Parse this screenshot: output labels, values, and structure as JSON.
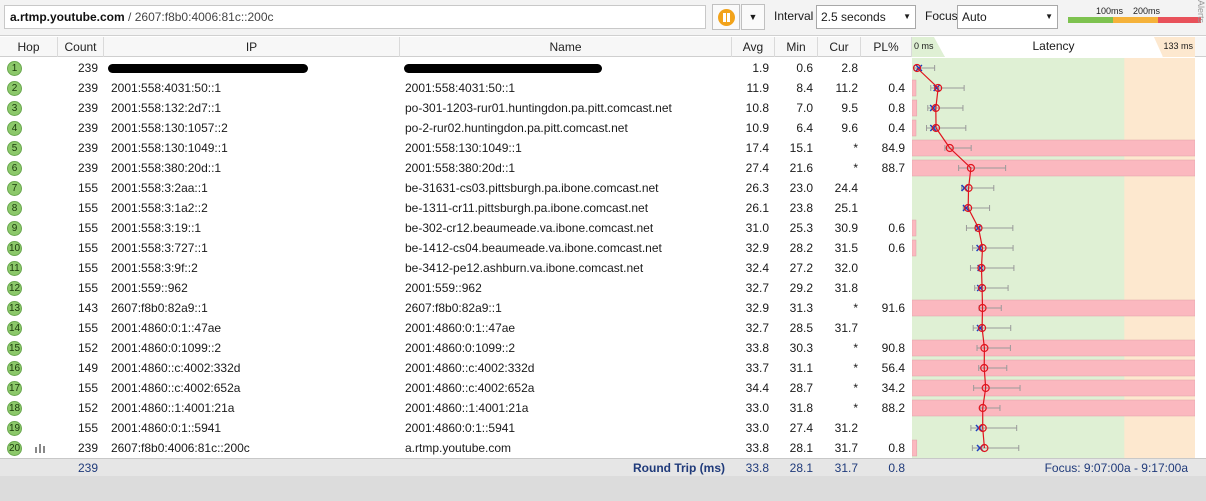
{
  "toolbar": {
    "host": "a.rtmp.youtube.com",
    "separator": "/",
    "ip": "2607:f8b0:4006:81c::200c",
    "interval_label": "Interval",
    "interval_value": "2.5 seconds",
    "focus_label": "Focus",
    "focus_value": "Auto",
    "legend_100": "100ms",
    "legend_200": "200ms",
    "alerts_label": "Alerts"
  },
  "columns": {
    "hop": "Hop",
    "count": "Count",
    "ip": "IP",
    "name": "Name",
    "avg": "Avg",
    "min": "Min",
    "cur": "Cur",
    "pl": "PL%",
    "latency": "Latency"
  },
  "latency_scale": {
    "min_label": "0 ms",
    "max_label": "133 ms"
  },
  "colors": {
    "good": "#dff0d4",
    "warn": "#fde8cf",
    "bad": "#fbb8bf",
    "line": "#e0141e",
    "hop_badge": "#8cc86a"
  },
  "hops": [
    {
      "hop": "1",
      "count": "239",
      "ip": "",
      "name": "",
      "avg": "1.9",
      "min": "0.6",
      "cur": "2.8",
      "pl": "",
      "redacted": true
    },
    {
      "hop": "2",
      "count": "239",
      "ip": "2001:558:4031:50::1",
      "name": "2001:558:4031:50::1",
      "avg": "11.9",
      "min": "8.4",
      "cur": "11.2",
      "pl": "0.4"
    },
    {
      "hop": "3",
      "count": "239",
      "ip": "2001:558:132:2d7::1",
      "name": "po-301-1203-rur01.huntingdon.pa.pitt.comcast.net",
      "avg": "10.8",
      "min": "7.0",
      "cur": "9.5",
      "pl": "0.8"
    },
    {
      "hop": "4",
      "count": "239",
      "ip": "2001:558:130:1057::2",
      "name": "po-2-rur02.huntingdon.pa.pitt.comcast.net",
      "avg": "10.9",
      "min": "6.4",
      "cur": "9.6",
      "pl": "0.4"
    },
    {
      "hop": "5",
      "count": "239",
      "ip": "2001:558:130:1049::1",
      "name": "2001:558:130:1049::1",
      "avg": "17.4",
      "min": "15.1",
      "cur": "*",
      "pl": "84.9"
    },
    {
      "hop": "6",
      "count": "239",
      "ip": "2001:558:380:20d::1",
      "name": "2001:558:380:20d::1",
      "avg": "27.4",
      "min": "21.6",
      "cur": "*",
      "pl": "88.7"
    },
    {
      "hop": "7",
      "count": "155",
      "ip": "2001:558:3:2aa::1",
      "name": "be-31631-cs03.pittsburgh.pa.ibone.comcast.net",
      "avg": "26.3",
      "min": "23.0",
      "cur": "24.4",
      "pl": ""
    },
    {
      "hop": "8",
      "count": "155",
      "ip": "2001:558:3:1a2::2",
      "name": "be-1311-cr11.pittsburgh.pa.ibone.comcast.net",
      "avg": "26.1",
      "min": "23.8",
      "cur": "25.1",
      "pl": ""
    },
    {
      "hop": "9",
      "count": "155",
      "ip": "2001:558:3:19::1",
      "name": "be-302-cr12.beaumeade.va.ibone.comcast.net",
      "avg": "31.0",
      "min": "25.3",
      "cur": "30.9",
      "pl": "0.6"
    },
    {
      "hop": "10",
      "count": "155",
      "ip": "2001:558:3:727::1",
      "name": "be-1412-cs04.beaumeade.va.ibone.comcast.net",
      "avg": "32.9",
      "min": "28.2",
      "cur": "31.5",
      "pl": "0.6"
    },
    {
      "hop": "11",
      "count": "155",
      "ip": "2001:558:3:9f::2",
      "name": "be-3412-pe12.ashburn.va.ibone.comcast.net",
      "avg": "32.4",
      "min": "27.2",
      "cur": "32.0",
      "pl": ""
    },
    {
      "hop": "12",
      "count": "155",
      "ip": "2001:559::962",
      "name": "2001:559::962",
      "avg": "32.7",
      "min": "29.2",
      "cur": "31.8",
      "pl": ""
    },
    {
      "hop": "13",
      "count": "143",
      "ip": "2607:f8b0:82a9::1",
      "name": "2607:f8b0:82a9::1",
      "avg": "32.9",
      "min": "31.3",
      "cur": "*",
      "pl": "91.6"
    },
    {
      "hop": "14",
      "count": "155",
      "ip": "2001:4860:0:1::47ae",
      "name": "2001:4860:0:1::47ae",
      "avg": "32.7",
      "min": "28.5",
      "cur": "31.7",
      "pl": ""
    },
    {
      "hop": "15",
      "count": "152",
      "ip": "2001:4860:0:1099::2",
      "name": "2001:4860:0:1099::2",
      "avg": "33.8",
      "min": "30.3",
      "cur": "*",
      "pl": "90.8"
    },
    {
      "hop": "16",
      "count": "149",
      "ip": "2001:4860::c:4002:332d",
      "name": "2001:4860::c:4002:332d",
      "avg": "33.7",
      "min": "31.1",
      "cur": "*",
      "pl": "56.4"
    },
    {
      "hop": "17",
      "count": "155",
      "ip": "2001:4860::c:4002:652a",
      "name": "2001:4860::c:4002:652a",
      "avg": "34.4",
      "min": "28.7",
      "cur": "*",
      "pl": "34.2"
    },
    {
      "hop": "18",
      "count": "152",
      "ip": "2001:4860::1:4001:21a",
      "name": "2001:4860::1:4001:21a",
      "avg": "33.0",
      "min": "31.8",
      "cur": "*",
      "pl": "88.2"
    },
    {
      "hop": "19",
      "count": "155",
      "ip": "2001:4860:0:1::5941",
      "name": "2001:4860:0:1::5941",
      "avg": "33.0",
      "min": "27.4",
      "cur": "31.2",
      "pl": ""
    },
    {
      "hop": "20",
      "count": "239",
      "ip": "2607:f8b0:4006:81c::200c",
      "name": "a.rtmp.youtube.com",
      "avg": "33.8",
      "min": "28.1",
      "cur": "31.7",
      "pl": "0.8",
      "has_icon": true
    }
  ],
  "footer": {
    "count": "239",
    "label": "Round Trip (ms)",
    "avg": "33.8",
    "min": "28.1",
    "cur": "31.7",
    "pl": "0.8",
    "focus": "Focus: 9:07:00a - 9:17:00a"
  }
}
